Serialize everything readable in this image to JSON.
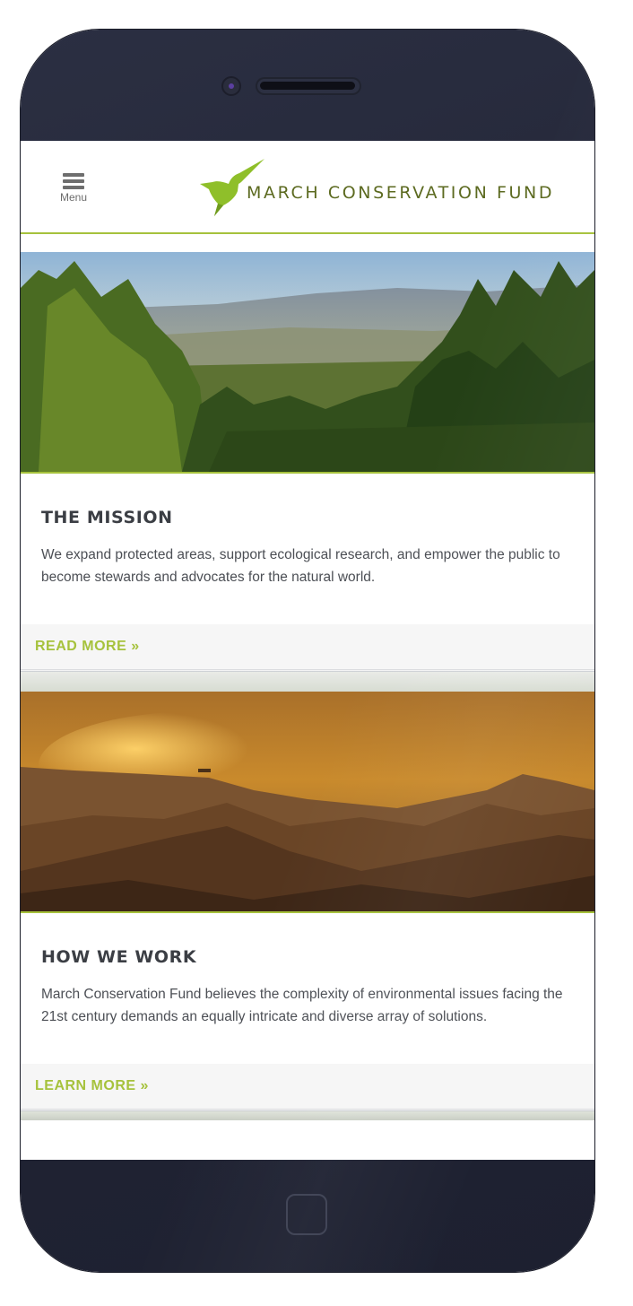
{
  "header": {
    "menu_label": "Menu",
    "logo_text": "MARCH CONSERVATION FUND",
    "accent_color": "#a6c23c"
  },
  "cards": [
    {
      "title": "THE MISSION",
      "text": "We expand protected areas, support ecological research, and empower the public to become stewards and advocates for the natural world.",
      "cta": "READ MORE »",
      "image": "forest-valley-landscape"
    },
    {
      "title": "HOW WE WORK",
      "text": "March Conservation Fund believes the complexity of environmental issues facing the 21st century demands an equally intricate and diverse array of solutions.",
      "cta": "LEARN MORE »",
      "image": "golden-bay-sunset-mountains"
    }
  ],
  "icons": {
    "menu": "hamburger-icon",
    "logo": "hummingbird-icon"
  }
}
